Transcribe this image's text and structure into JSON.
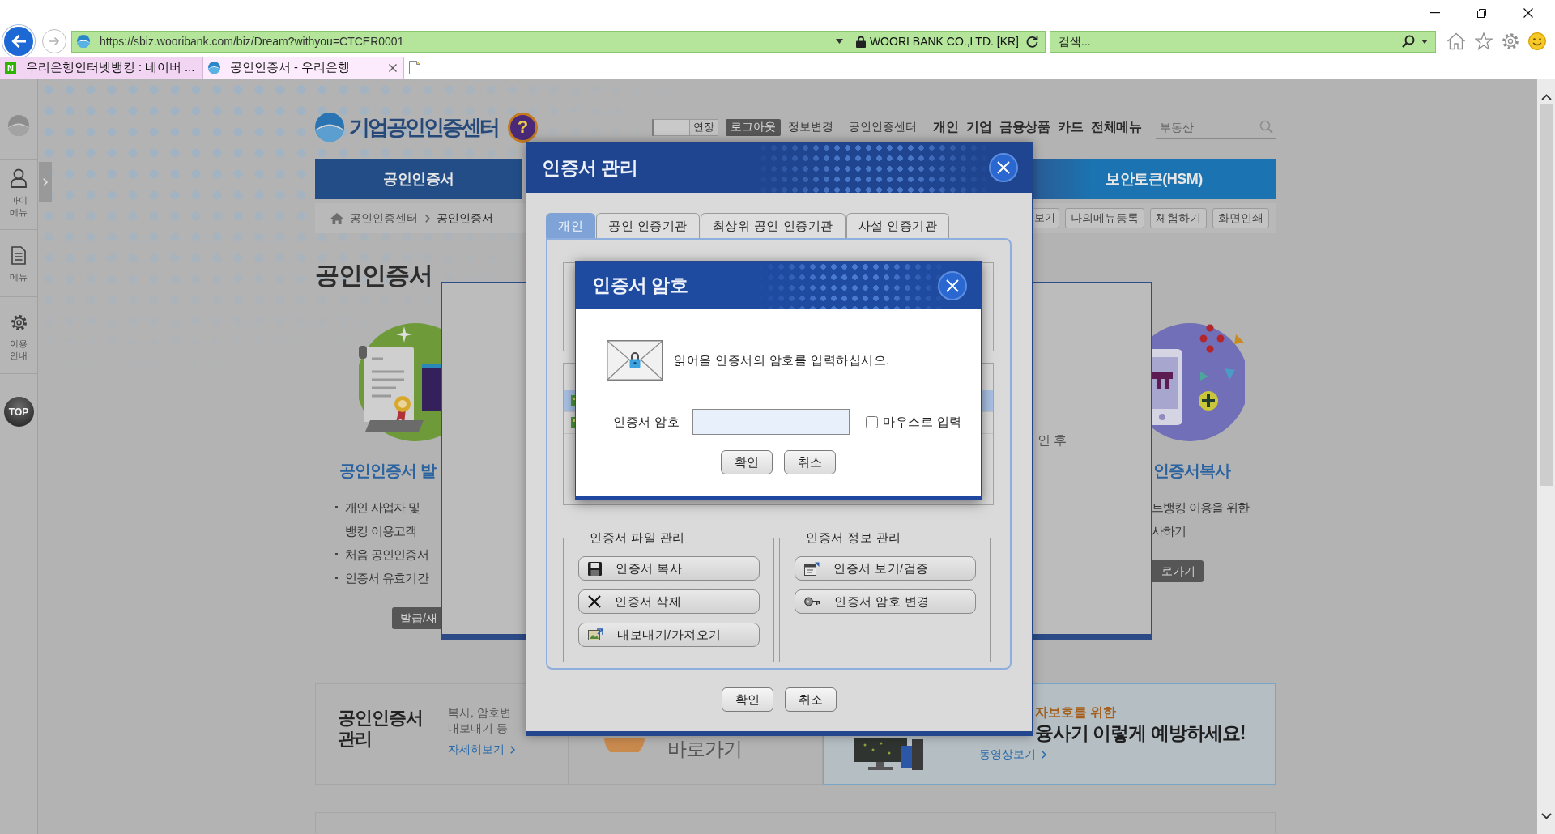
{
  "browser": {
    "nav_buttons": [
      {
        "kind": "back",
        "disabled": false
      },
      {
        "kind": "forward",
        "disabled": true
      }
    ],
    "address_bar": {
      "url": "https://sbiz.wooribank.com/biz/Dream?withyou=CTCER0001",
      "identity": "WOORI BANK CO.,LTD. [KR]"
    },
    "search": {
      "placeholder": "검색..."
    },
    "tabs": [
      {
        "title": "우리은행인터넷뱅킹 : 네이버 ...",
        "favicon": {
          "kind": "letter",
          "text": "N"
        },
        "selected": false
      },
      {
        "title": "공인인증서 - 우리은행",
        "favicon": {
          "kind": "swirl"
        },
        "selected": true
      }
    ]
  },
  "sidebar": {
    "items": [
      {
        "kind": "person",
        "label": "마이 메뉴"
      },
      {
        "kind": "document",
        "label": "메뉴"
      },
      {
        "kind": "gear",
        "label": "이용 안내"
      }
    ],
    "top_button": "TOP"
  },
  "header": {
    "logo": "기업공인인증센터",
    "help": "?",
    "session": {
      "extend": "연장",
      "logout": "로그아웃"
    },
    "links": [
      "정보변경",
      "공인인증센터"
    ],
    "menu": [
      "개인",
      "기업",
      "금융상품",
      "카드",
      "전체메뉴"
    ],
    "search": {
      "placeholder": "부동산"
    }
  },
  "nav": {
    "tabs": [
      {
        "label": "공인인증서",
        "selected": true
      },
      {
        "label": "보안토큰(HSM)",
        "selected": false
      }
    ]
  },
  "breadcrumb": {
    "items": [
      "공인인증센터",
      "공인인증서"
    ],
    "tools": [
      "보기",
      "나의메뉴등록",
      "체험하기",
      "화면인쇄"
    ]
  },
  "page_title": "공인인증서",
  "services": [
    {
      "kind": "certificate",
      "title": "공인인증서 발",
      "items": [
        [
          "개인 사업자 및",
          "뱅킹 이용고객"
        ],
        [
          "처음 공인인증서"
        ],
        [
          "인증서 유효기간"
        ]
      ],
      "button": "발급/재"
    },
    {
      "kind": "phone",
      "title": "인증서복사",
      "items": [
        [
          "트뱅킹 이용을 위한",
          "사하기"
        ]
      ],
      "button": "로가기"
    }
  ],
  "cards": [
    {
      "kind": "info",
      "title": "공인인증서 관리",
      "lines": [
        "복사, 암호변",
        "내보내기 등"
      ],
      "link": "자세히보기"
    },
    {
      "kind": "shortcut",
      "title": "바로가기"
    },
    {
      "kind": "video",
      "eyebrow": "자보호를 위한",
      "title": "융사기 이렇게 예방하세요!",
      "link": "동영상보기"
    }
  ],
  "popup_frame": {
    "texts": [
      "인 후"
    ]
  },
  "cert_manager": {
    "title": "인증서 관리",
    "tabs": [
      {
        "label": "개인",
        "selected": true
      },
      {
        "label": "공인 인증기관",
        "selected": false
      },
      {
        "label": "최상위 공인 인증기관",
        "selected": false
      },
      {
        "label": "사설 인증기관",
        "selected": false
      }
    ],
    "certificate_list": {
      "rows": [
        {
          "selected": true
        },
        {
          "selected": false
        }
      ]
    },
    "groups": [
      {
        "title": "인증서 파일 관리",
        "buttons": [
          {
            "kind": "floppy",
            "label": "인증서 복사"
          },
          {
            "kind": "delete",
            "label": "인증서 삭제"
          },
          {
            "kind": "export",
            "label": "내보내기/가져오기"
          }
        ]
      },
      {
        "title": "인증서 정보 관리",
        "buttons": [
          {
            "kind": "view",
            "label": "인증서 보기/검증"
          },
          {
            "kind": "password",
            "label": "인증서 암호 변경"
          }
        ]
      }
    ],
    "buttons": [
      "확인",
      "취소"
    ]
  },
  "password_dialog": {
    "title": "인증서 암호",
    "message": "읽어올 인증서의 암호를 입력하십시오.",
    "field_label": "인증서 암호",
    "mouse_input": {
      "label": "마우스로 입력",
      "checked": false
    },
    "buttons": [
      "확인",
      "취소"
    ]
  }
}
